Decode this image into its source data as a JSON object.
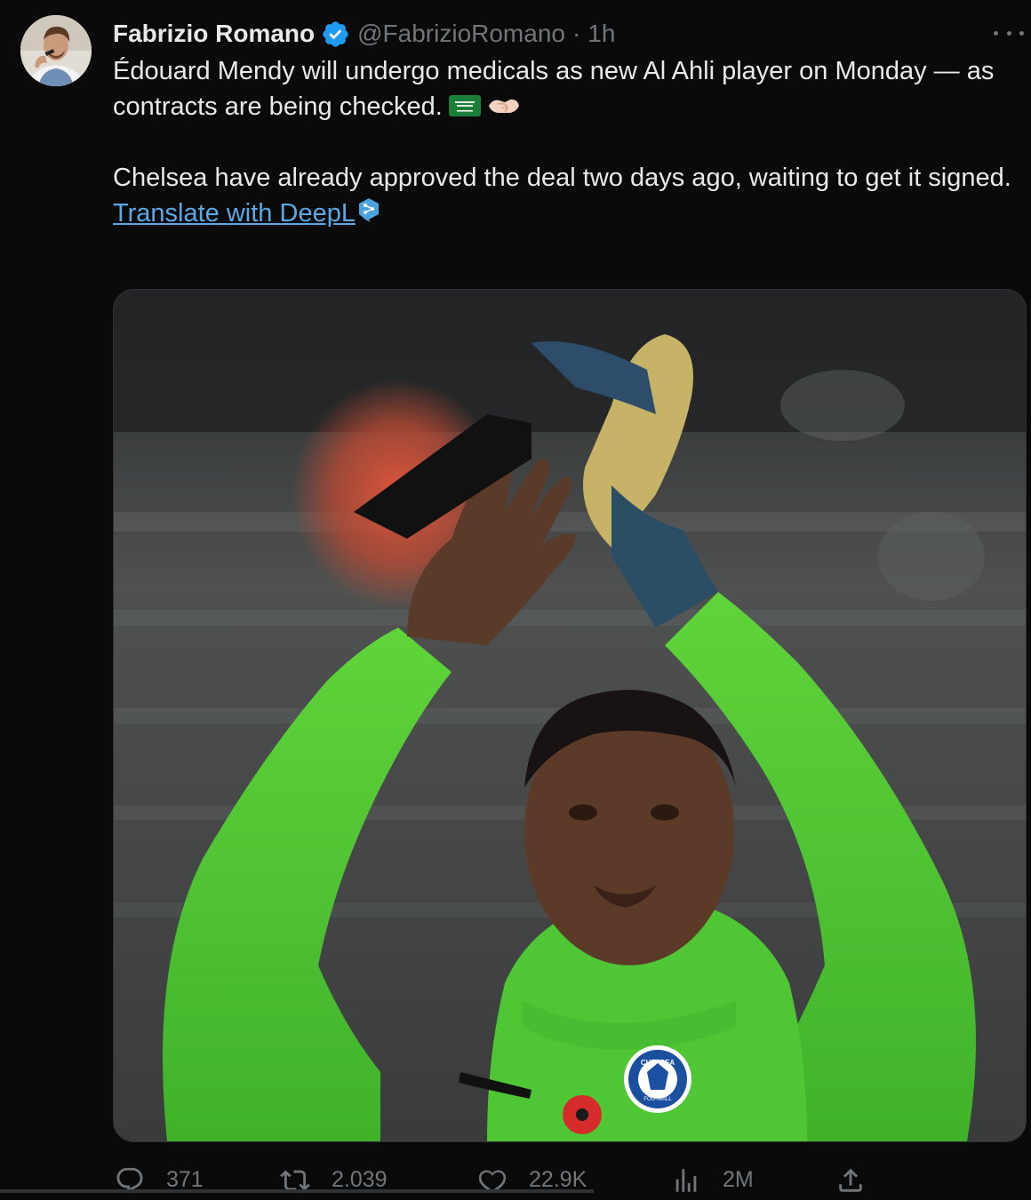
{
  "author": {
    "display_name": "Fabrizio Romano",
    "handle": "@FabrizioRomano",
    "separator": "·",
    "time": "1h"
  },
  "tweet": {
    "paragraph_1": "Édouard Mendy will undergo medicals as new Al Ahli player on Monday — as contracts are being checked.",
    "paragraph_2": "Chelsea have already approved the deal two days ago, waiting to get it signed.",
    "translate_link": "Translate with DeepL"
  },
  "media": {
    "jersey_badge_text": "CHELSEA",
    "jersey_badge_subtext": "FOOTBALL"
  },
  "actions": {
    "replies": "371",
    "retweets": "2.039",
    "likes": "22.9K",
    "views": "2M"
  },
  "colors": {
    "background": "#0a0a0a",
    "text": "#e7e9ea",
    "muted": "#71767b",
    "link": "#5aa9e6",
    "verified": "#1d9bf0"
  }
}
